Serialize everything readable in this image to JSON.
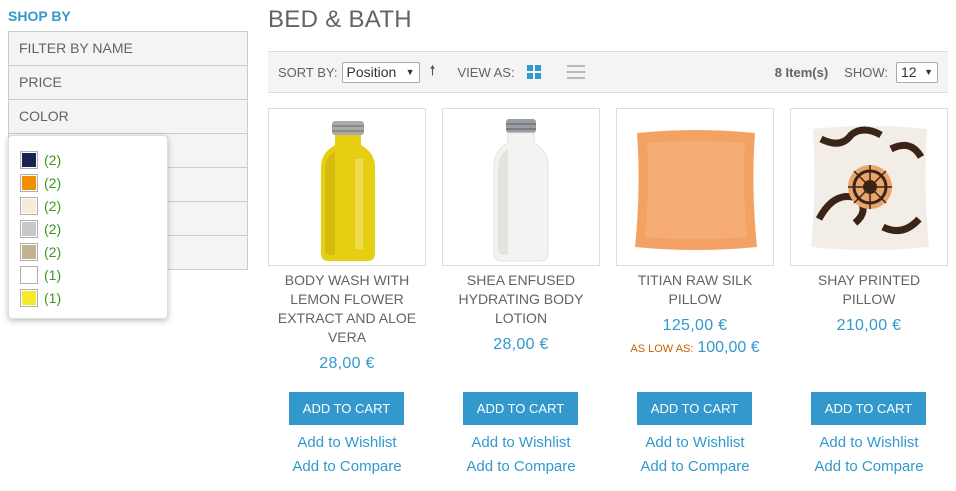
{
  "sidebar": {
    "heading": "SHOP BY",
    "filters": [
      "FILTER BY NAME",
      "PRICE",
      "COLOR",
      "",
      "",
      "",
      ""
    ],
    "color_swatches": [
      {
        "color": "#1b2250",
        "count": "(2)"
      },
      {
        "color": "#f08f00",
        "count": "(2)"
      },
      {
        "color": "#f7ecd6",
        "count": "(2)"
      },
      {
        "color": "#c8c8c8",
        "count": "(2)"
      },
      {
        "color": "#c2b290",
        "count": "(2)"
      },
      {
        "color": "#ffffff",
        "count": "(1)"
      },
      {
        "color": "#f6ea2a",
        "count": "(1)"
      }
    ]
  },
  "main": {
    "title": "BED & BATH",
    "toolbar": {
      "sort_label": "SORT BY:",
      "sort_value": "Position",
      "view_label": "VIEW AS:",
      "items_count": "8 Item(s)",
      "show_label": "SHOW:",
      "show_value": "12"
    },
    "products": [
      {
        "name": "BODY WASH WITH LEMON FLOWER EXTRACT AND ALOE VERA",
        "price": "28,00 €",
        "image": "yellow-bottle"
      },
      {
        "name": "SHEA ENFUSED HYDRATING BODY LOTION",
        "price": "28,00 €",
        "image": "white-bottle"
      },
      {
        "name": "TITIAN RAW SILK PILLOW",
        "price": "125,00 €",
        "as_low_label": "AS LOW AS:",
        "as_low_price": "100,00 €",
        "image": "orange-pillow"
      },
      {
        "name": "SHAY PRINTED PILLOW",
        "price": "210,00 €",
        "image": "printed-pillow"
      }
    ],
    "add_to_cart_label": "ADD TO CART",
    "wishlist_label": "Add to Wishlist",
    "compare_label": "Add to Compare"
  }
}
